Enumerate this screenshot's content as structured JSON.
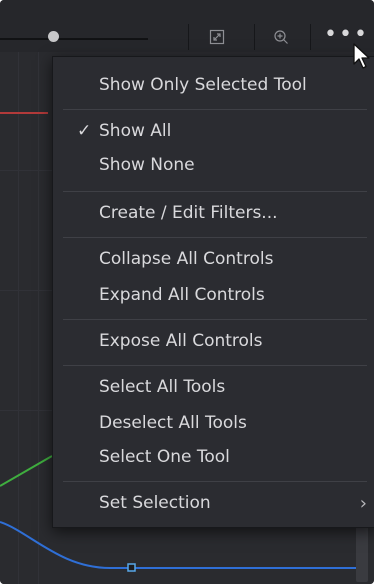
{
  "toolbar": {
    "fit_icon": "fit-to-window-icon",
    "zoom_icon": "zoom-icon",
    "more_label": "•••",
    "more_icon": "more-options-icon"
  },
  "menu": {
    "items": [
      {
        "label": "Show Only Selected Tool",
        "checked": false
      },
      {
        "label": "Show All",
        "checked": true,
        "check_mark": "✓"
      },
      {
        "label": "Show None",
        "checked": false
      },
      {
        "label": "Create / Edit Filters...",
        "checked": false
      },
      {
        "label": "Collapse All Controls",
        "checked": false
      },
      {
        "label": "Expand All Controls",
        "checked": false
      },
      {
        "label": "Expose All Controls",
        "checked": false
      },
      {
        "label": "Select All Tools",
        "checked": false
      },
      {
        "label": "Deselect All Tools",
        "checked": false
      },
      {
        "label": "Select One Tool",
        "checked": false
      },
      {
        "label": "Set Selection",
        "checked": false,
        "submenu": true,
        "chevron": "›"
      }
    ]
  },
  "colors": {
    "background": "#202124",
    "menu_bg": "#2b2c31",
    "text": "#d9d9dc",
    "curve_blue": "#2f6fd6",
    "curve_green": "#3fae3f",
    "red_marker": "#b23a3a"
  }
}
